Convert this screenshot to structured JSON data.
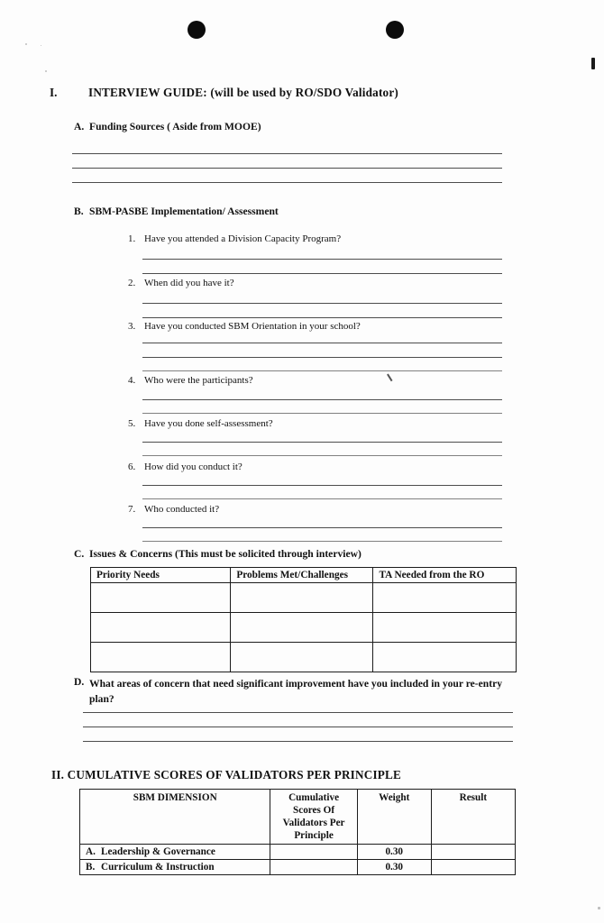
{
  "document": {
    "sections": [
      {
        "numeral": "I.",
        "title": "INTERVIEW GUIDE: (will be used by RO/SDO Validator)",
        "subsections": [
          {
            "letter": "A.",
            "title": "Funding Sources ( Aside from MOOE)",
            "answer_lines": 3
          },
          {
            "letter": "B.",
            "title": "SBM-PASBE Implementation/ Assessment",
            "questions": [
              {
                "number": "1.",
                "text": "Have you attended a Division Capacity Program?"
              },
              {
                "number": "2.",
                "text": "When did you have it?"
              },
              {
                "number": "3.",
                "text": "Have you conducted SBM Orientation in your school?"
              },
              {
                "number": "4.",
                "text": "Who were the participants?"
              },
              {
                "number": "5.",
                "text": "Have you done self-assessment?"
              },
              {
                "number": "6.",
                "text": "How did you conduct it?"
              },
              {
                "number": "7.",
                "text": "Who conducted it?"
              }
            ]
          },
          {
            "letter": "C.",
            "title": "Issues & Concerns (This must be solicited through interview)",
            "table": {
              "headers": [
                "Priority Needs",
                "Problems Met/Challenges",
                "TA Needed from the RO"
              ],
              "rows": [
                [
                  "",
                  "",
                  ""
                ],
                [
                  "",
                  "",
                  ""
                ],
                [
                  "",
                  "",
                  ""
                ]
              ]
            }
          },
          {
            "letter": "D.",
            "title": "What areas of concern that need significant improvement have you included in your re-entry plan?",
            "answer_lines": 3
          }
        ]
      },
      {
        "numeral": "II.",
        "title": "CUMULATIVE SCORES OF VALIDATORS PER PRINCIPLE",
        "table": {
          "headers": [
            "SBM DIMENSION",
            "Cumulative Scores Of Validators Per Principle",
            "Weight",
            "Result"
          ],
          "rows": [
            {
              "letter": "A.",
              "dimension": "Leadership & Governance",
              "cumulative": "",
              "weight": "0.30",
              "result": ""
            },
            {
              "letter": "B.",
              "dimension": "Curriculum & Instruction",
              "cumulative": "",
              "weight": "0.30",
              "result": ""
            }
          ]
        }
      }
    ]
  }
}
